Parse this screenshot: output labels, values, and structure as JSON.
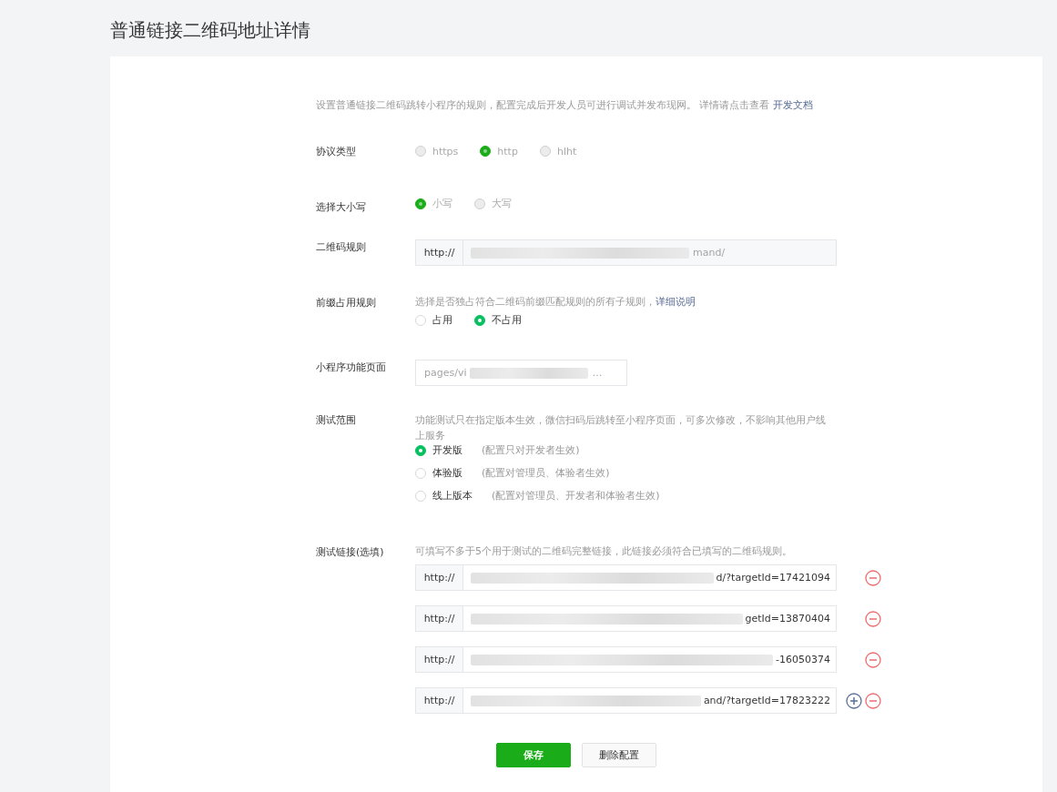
{
  "page_title": "普通链接二维码地址详情",
  "intro": {
    "text": "设置普通链接二维码跳转小程序的规则，配置完成后开发人员可进行调试并发布现网。 详情请点击查看",
    "link": "开发文档"
  },
  "protocol": {
    "label": "协议类型",
    "options": [
      {
        "label": "https",
        "selected": false,
        "disabled": true
      },
      {
        "label": "http",
        "selected": true,
        "disabled": true
      },
      {
        "label": "hlht",
        "selected": false,
        "disabled": true
      }
    ]
  },
  "letter_case": {
    "label": "选择大小写",
    "options": [
      {
        "label": "小写",
        "selected": true,
        "disabled": true
      },
      {
        "label": "大写",
        "selected": false,
        "disabled": true
      }
    ]
  },
  "qr_rule": {
    "label": "二维码规则",
    "prefix": "http://",
    "value": "mand/"
  },
  "prefix_rule": {
    "label": "前缀占用规则",
    "hint": "选择是否独占符合二维码前缀匹配规则的所有子规则，",
    "link": "详细说明",
    "options": [
      {
        "label": "占用",
        "selected": false,
        "disabled": false
      },
      {
        "label": "不占用",
        "selected": true,
        "disabled": false
      }
    ]
  },
  "page": {
    "label": "小程序功能页面",
    "value_start": "pages/vi",
    "value_end": "…"
  },
  "test_scope": {
    "label": "测试范围",
    "hint": "功能测试只在指定版本生效，微信扫码后跳转至小程序页面，可多次修改，不影响其他用户线上服务",
    "options": [
      {
        "label": "开发版",
        "note": "(配置只对开发者生效)",
        "selected": true,
        "disabled": false
      },
      {
        "label": "体验版",
        "note": "(配置对管理员、体验者生效)",
        "selected": false,
        "disabled": false
      },
      {
        "label": "线上版本",
        "note": "(配置对管理员、开发者和体验者生效)",
        "selected": false,
        "disabled": false
      }
    ]
  },
  "test_links": {
    "label": "测试链接(选填)",
    "hint": "可填写不多于5个用于测试的二维码完整链接，此链接必须符合已填写的二维码规则。",
    "rows": [
      {
        "prefix": "http://",
        "value": "d/?targetId=17421094",
        "can_add": false
      },
      {
        "prefix": "http://",
        "value": "getId=13870404",
        "can_add": false
      },
      {
        "prefix": "http://",
        "value": "-16050374",
        "can_add": false
      },
      {
        "prefix": "http://",
        "value": "and/?targetId=17823222",
        "can_add": true
      }
    ]
  },
  "buttons": {
    "save": "保存",
    "delete": "删除配置"
  }
}
